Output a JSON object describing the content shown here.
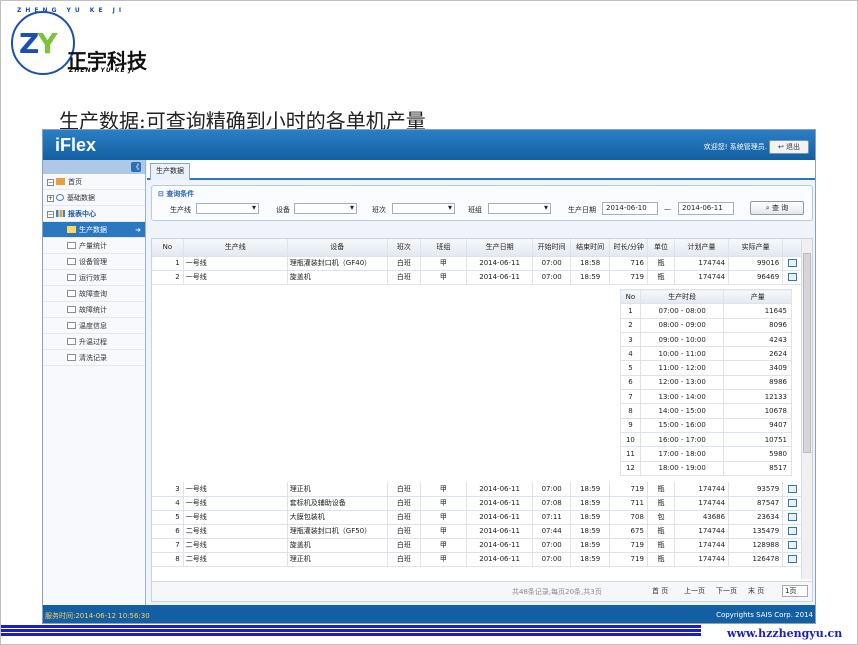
{
  "logo": {
    "cn": "正宇科技",
    "en": "ZHENG YU KE JI",
    "ring_text": "ZHENG YU KE JI",
    "mark_z": "Z",
    "mark_y": "Y"
  },
  "heading": "生产数据:可查询精确到小时的各单机产量",
  "app": {
    "brand": "iFlex",
    "welcome": "欢迎您! 系统管理员.",
    "logout": "退出",
    "sidebar": {
      "collapse": "《",
      "items": [
        {
          "label": "首页",
          "kind": "top"
        },
        {
          "label": "基础数据",
          "kind": "top"
        },
        {
          "label": "报表中心",
          "kind": "top"
        },
        {
          "label": "生产数据",
          "kind": "sub",
          "active": true
        },
        {
          "label": "产量统计",
          "kind": "sub"
        },
        {
          "label": "设备管理",
          "kind": "sub"
        },
        {
          "label": "运行效率",
          "kind": "sub"
        },
        {
          "label": "故障查询",
          "kind": "sub"
        },
        {
          "label": "故障统计",
          "kind": "sub"
        },
        {
          "label": "温度信息",
          "kind": "sub"
        },
        {
          "label": "升温过程",
          "kind": "sub"
        },
        {
          "label": "清洗记录",
          "kind": "sub"
        }
      ]
    },
    "tab": "生产数据",
    "query": {
      "title": "查询条件",
      "line_label": "生产线",
      "device_label": "设备",
      "shift_label": "班次",
      "group_label": "班组",
      "date_label": "生产日期",
      "date_from": "2014-06-10",
      "date_sep": "—",
      "date_to": "2014-06-11",
      "search_button": "查 询"
    },
    "table": {
      "headers": [
        "No",
        "生产线",
        "设备",
        "班次",
        "班组",
        "生产日期",
        "开始时间",
        "结束时间",
        "时长/分钟",
        "单位",
        "计划产量",
        "实际产量"
      ],
      "rows": [
        [
          "1",
          "一号线",
          "理瓶灌装封口机（GF40）",
          "白班",
          "甲",
          "2014-06-11",
          "07:00",
          "18:58",
          "716",
          "瓶",
          "174744",
          "99016"
        ],
        [
          "2",
          "一号线",
          "旋盖机",
          "白班",
          "甲",
          "2014-06-11",
          "07:00",
          "18:59",
          "719",
          "瓶",
          "174744",
          "96469"
        ],
        [
          "3",
          "一号线",
          "理正机",
          "白班",
          "甲",
          "2014-06-11",
          "07:00",
          "18:59",
          "719",
          "瓶",
          "174744",
          "93579"
        ],
        [
          "4",
          "一号线",
          "套标机及辅助设备",
          "白班",
          "甲",
          "2014-06-11",
          "07:08",
          "18:59",
          "711",
          "瓶",
          "174744",
          "87547"
        ],
        [
          "5",
          "一号线",
          "大膜包装机",
          "白班",
          "甲",
          "2014-06-11",
          "07:11",
          "18:59",
          "708",
          "包",
          "43686",
          "23634"
        ],
        [
          "6",
          "二号线",
          "理瓶灌装封口机（GF50）",
          "白班",
          "甲",
          "2014-06-11",
          "07:44",
          "18:59",
          "675",
          "瓶",
          "174744",
          "135479"
        ],
        [
          "7",
          "二号线",
          "旋盖机",
          "白班",
          "甲",
          "2014-06-11",
          "07:00",
          "18:59",
          "719",
          "瓶",
          "174744",
          "128988"
        ],
        [
          "8",
          "二号线",
          "理正机",
          "白班",
          "甲",
          "2014-06-11",
          "07:00",
          "18:59",
          "719",
          "瓶",
          "174744",
          "126478"
        ]
      ]
    },
    "detail": {
      "headers": [
        "No",
        "生产时段",
        "产量"
      ],
      "rows": [
        [
          "1",
          "07:00 - 08:00",
          "11645"
        ],
        [
          "2",
          "08:00 - 09:00",
          "8096"
        ],
        [
          "3",
          "09:00 - 10:00",
          "4243"
        ],
        [
          "4",
          "10:00 - 11:00",
          "2624"
        ],
        [
          "5",
          "11:00 - 12:00",
          "3409"
        ],
        [
          "6",
          "12:00 - 13:00",
          "8986"
        ],
        [
          "7",
          "13:00 - 14:00",
          "12133"
        ],
        [
          "8",
          "14:00 - 15:00",
          "10678"
        ],
        [
          "9",
          "15:00 - 16:00",
          "9407"
        ],
        [
          "10",
          "16:00 - 17:00",
          "10751"
        ],
        [
          "11",
          "17:00 - 18:00",
          "5980"
        ],
        [
          "12",
          "18:00 - 19:00",
          "8517"
        ]
      ]
    },
    "pager": {
      "info": "共48条记录,每页20条,共3页",
      "first": "首 页",
      "prev": "上一页",
      "next": "下一页",
      "last": "末 页",
      "page_select": "1页"
    },
    "footer": {
      "status": "服务时间:2014-06-12 10:56:30",
      "copyright": "Copyrights SAIS Corp. 2014"
    }
  },
  "website": "www.hzzhengyu.cn",
  "colors": {
    "brand_blue": "#135fa3",
    "accent_blue": "#2c78c0",
    "stripe": "#1b1ec4",
    "logo_green": "#7cc23a"
  }
}
